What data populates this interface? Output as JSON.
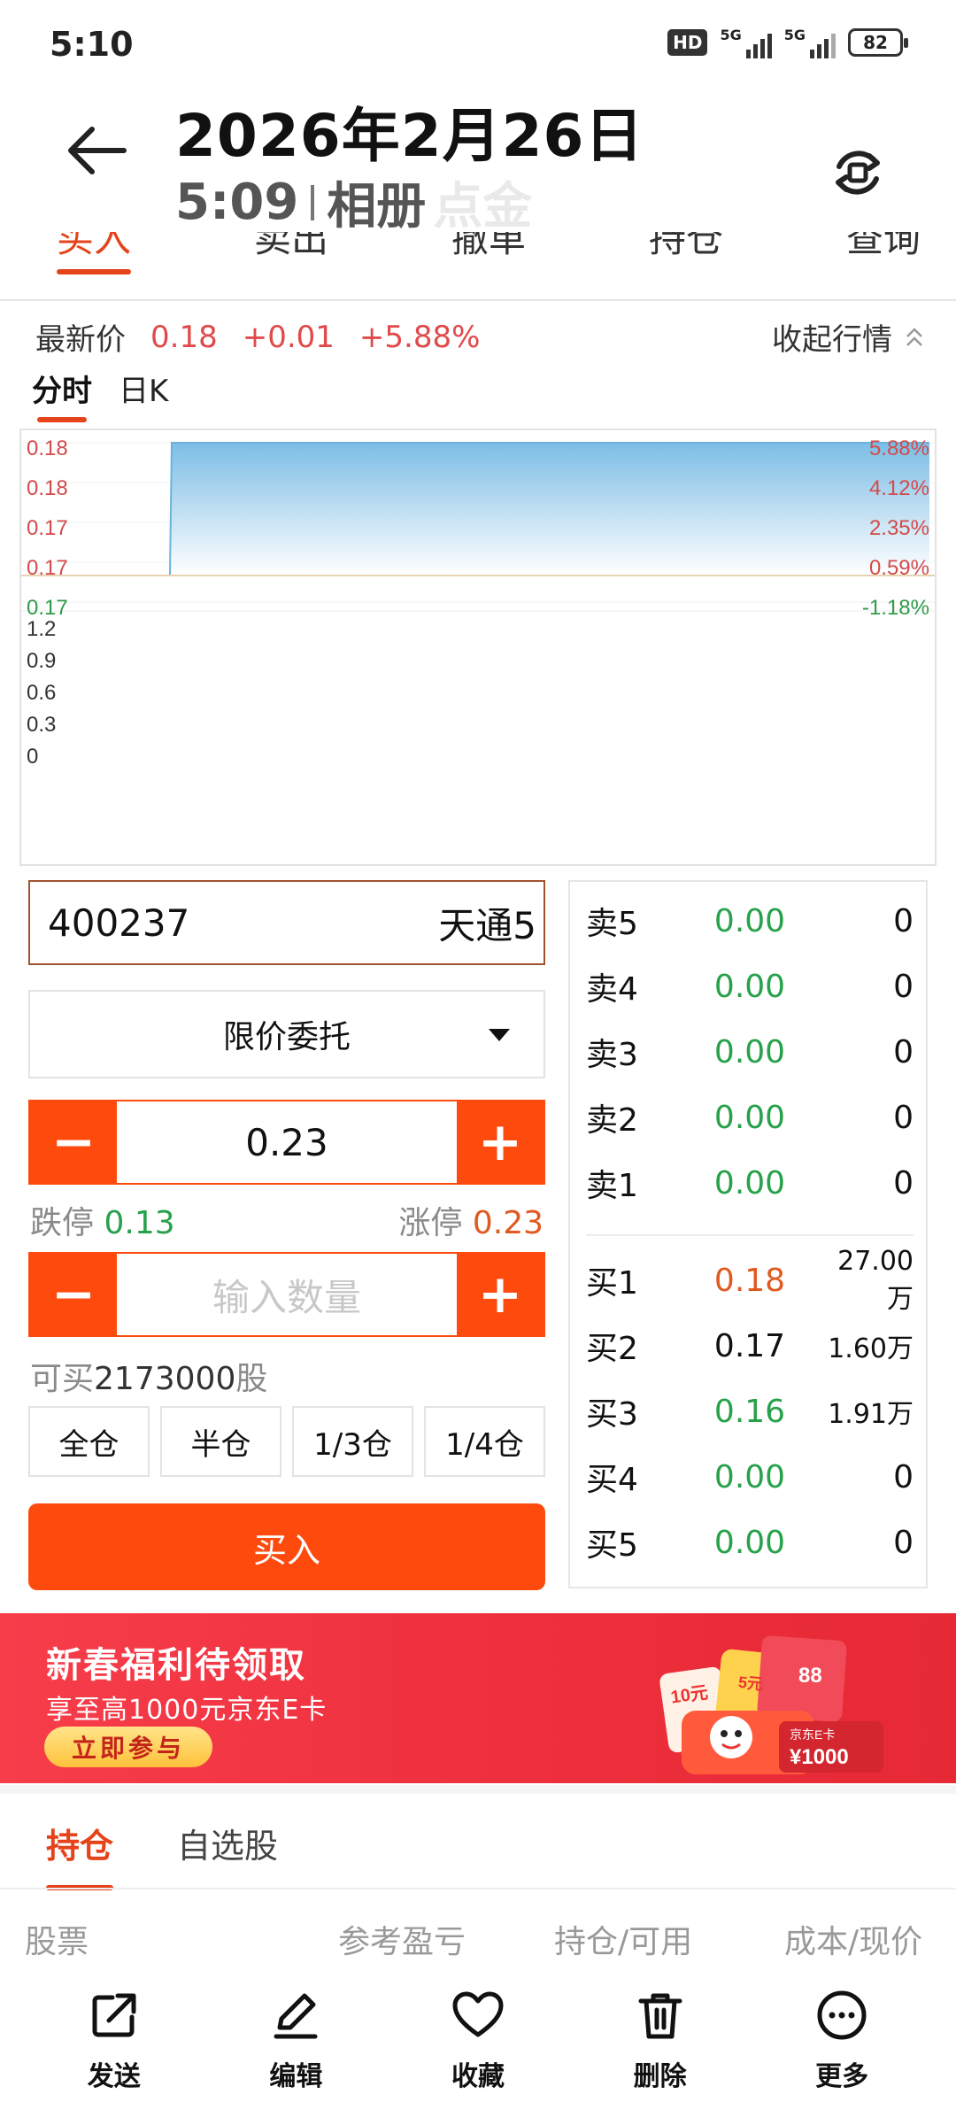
{
  "status_bar": {
    "time": "5:10",
    "hd": "HD",
    "net1": "5G",
    "net2": "5G",
    "battery": "82"
  },
  "header": {
    "date": "2026年2月26日",
    "time": "5:09",
    "album": "相册",
    "faded_title": "点金"
  },
  "trade_tabs": {
    "items": [
      "买入",
      "卖出",
      "撤单",
      "持仓",
      "查询"
    ],
    "active_index": 0
  },
  "quote": {
    "label": "最新价",
    "price": "0.18",
    "change": "+0.01",
    "change_pct": "+5.88%",
    "collapse_label": "收起行情",
    "chart_tabs": [
      "分时",
      "日K"
    ]
  },
  "chart_data": {
    "type": "line",
    "price_axis_labels": [
      "0.18",
      "0.18",
      "0.17",
      "0.17",
      "0.17"
    ],
    "pct_axis_labels": [
      "5.88%",
      "4.12%",
      "2.35%",
      "0.59%",
      "-1.18%"
    ],
    "volume_axis_labels": [
      "1.2",
      "0.9",
      "0.6",
      "0.3",
      "0"
    ],
    "series": [
      {
        "values": [
          0.17,
          0.17,
          0.17,
          0.18,
          0.18
        ]
      }
    ],
    "colors": {
      "line": "#6bb3dd",
      "fill_top": "#7cbde5",
      "up": "#d44a4a",
      "down": "#2f9a48",
      "baseline": "#e8d2b2"
    }
  },
  "order": {
    "stock_code": "400237",
    "stock_name": "天通5",
    "order_type": "限价委托",
    "price": "0.23",
    "limit_down_label": "跌停",
    "limit_down": "0.13",
    "limit_up_label": "涨停",
    "limit_up": "0.23",
    "qty_placeholder": "输入数量",
    "can_buy_prefix": "可买",
    "can_buy_qty": "2173000",
    "can_buy_unit": "股",
    "position_buttons": [
      "全仓",
      "半仓",
      "1/3仓",
      "1/4仓"
    ],
    "buy_label": "买入",
    "minus": "−",
    "plus": "+"
  },
  "order_book": {
    "sell": [
      {
        "label": "卖5",
        "price": "0.00",
        "volume": "0"
      },
      {
        "label": "卖4",
        "price": "0.00",
        "volume": "0"
      },
      {
        "label": "卖3",
        "price": "0.00",
        "volume": "0"
      },
      {
        "label": "卖2",
        "price": "0.00",
        "volume": "0"
      },
      {
        "label": "卖1",
        "price": "0.00",
        "volume": "0"
      }
    ],
    "buy": [
      {
        "label": "买1",
        "price": "0.18",
        "volume": "27.00万"
      },
      {
        "label": "买2",
        "price": "0.17",
        "volume": "1.60万"
      },
      {
        "label": "买3",
        "price": "0.16",
        "volume": "1.91万"
      },
      {
        "label": "买4",
        "price": "0.00",
        "volume": "0"
      },
      {
        "label": "买5",
        "price": "0.00",
        "volume": "0"
      }
    ],
    "colors": {
      "green": "#27a14a",
      "orange": "#e05a20",
      "black": "#111111"
    }
  },
  "banner": {
    "title": "新春福利待领取",
    "subtitle": "享至高1000元京东E卡",
    "cta": "立即参与",
    "coupon1": "10元",
    "coupon2": "5元",
    "card_brand": "京东E卡",
    "card_value": "¥1000",
    "ticket_number": "88"
  },
  "holdings": {
    "tabs": [
      "持仓",
      "自选股"
    ],
    "columns": [
      "股票",
      "参考盈亏",
      "持仓/可用",
      "成本/现价"
    ]
  },
  "action_bar": {
    "items": [
      {
        "label": "发送",
        "icon": "share-icon"
      },
      {
        "label": "编辑",
        "icon": "edit-icon"
      },
      {
        "label": "收藏",
        "icon": "heart-icon"
      },
      {
        "label": "删除",
        "icon": "trash-icon"
      },
      {
        "label": "更多",
        "icon": "more-icon"
      }
    ]
  }
}
